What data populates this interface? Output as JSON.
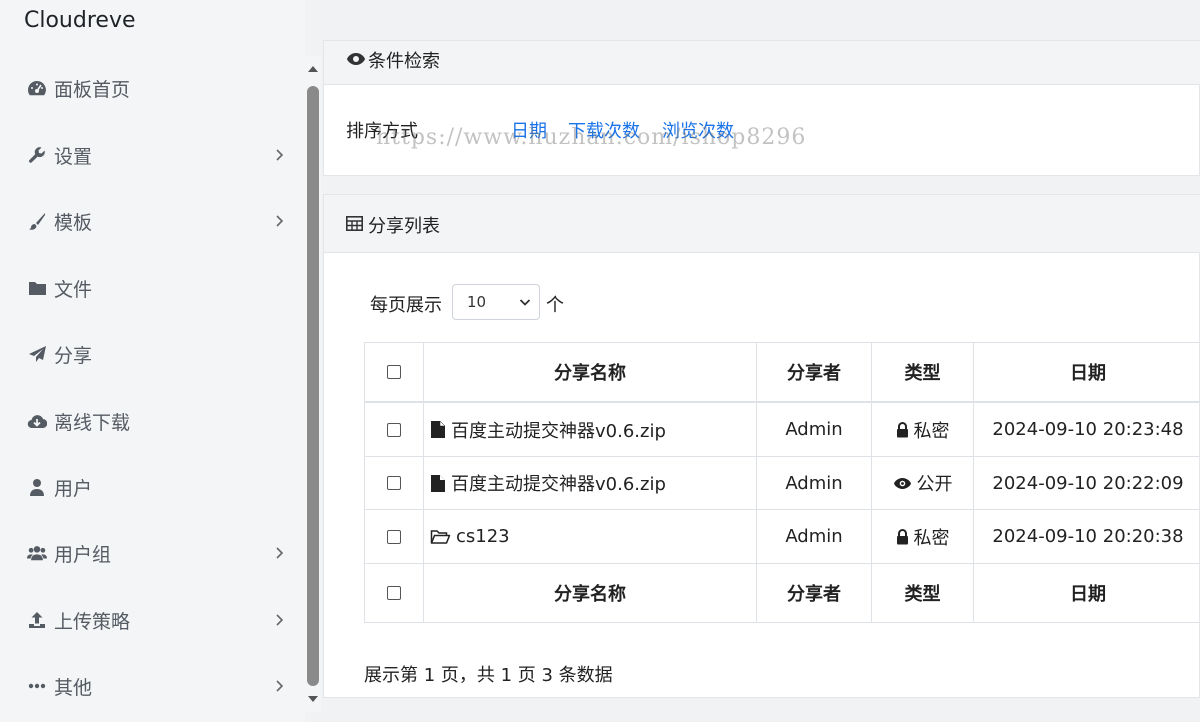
{
  "app": {
    "brand": "Cloudreve"
  },
  "sidebar": {
    "items": [
      {
        "label": "面板首页",
        "icon": "dashboard-icon",
        "has_submenu": false
      },
      {
        "label": "设置",
        "icon": "wrench-icon",
        "has_submenu": true
      },
      {
        "label": "模板",
        "icon": "paintbrush-icon",
        "has_submenu": true
      },
      {
        "label": "文件",
        "icon": "folder-icon",
        "has_submenu": false
      },
      {
        "label": "分享",
        "icon": "paper-plane-icon",
        "has_submenu": false
      },
      {
        "label": "离线下载",
        "icon": "cloud-download-icon",
        "has_submenu": false
      },
      {
        "label": "用户",
        "icon": "user-icon",
        "has_submenu": false
      },
      {
        "label": "用户组",
        "icon": "users-icon",
        "has_submenu": true
      },
      {
        "label": "上传策略",
        "icon": "upload-icon",
        "has_submenu": true
      },
      {
        "label": "其他",
        "icon": "ellipsis-icon",
        "has_submenu": true
      }
    ]
  },
  "filter_card": {
    "title": "条件检索",
    "sort_label": "排序方式",
    "sort_options": [
      "日期",
      "下载次数",
      "浏览次数"
    ],
    "watermark": "https://www.huzhan.com/ishop8296"
  },
  "share_card": {
    "title": "分享列表",
    "per_page_label": "每页展示",
    "per_page_value": "10",
    "per_page_unit": "个",
    "columns": [
      "分享名称",
      "分享者",
      "类型",
      "日期"
    ],
    "rows": [
      {
        "name": "百度主动提交神器v0.6.zip",
        "kind": "file",
        "owner": "Admin",
        "type": "私密",
        "type_icon": "lock-icon",
        "date": "2024-09-10 20:23:48"
      },
      {
        "name": "百度主动提交神器v0.6.zip",
        "kind": "file",
        "owner": "Admin",
        "type": "公开",
        "type_icon": "eye-icon",
        "date": "2024-09-10 20:22:09"
      },
      {
        "name": "cs123",
        "kind": "folder",
        "owner": "Admin",
        "type": "私密",
        "type_icon": "lock-icon",
        "date": "2024-09-10 20:20:38"
      }
    ],
    "pagination_info": "展示第 1 页，共 1 页 3 条数据"
  },
  "colors": {
    "link": "#1a73e8",
    "sidebar_bg": "#f4f5f7",
    "icon_gray": "#555b63"
  }
}
